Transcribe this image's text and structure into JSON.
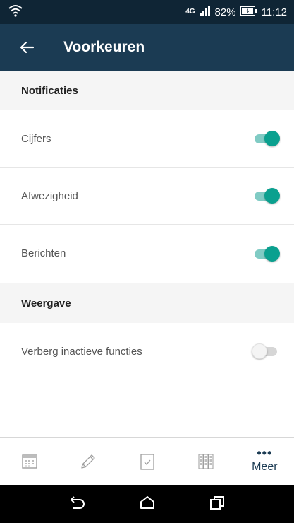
{
  "status_bar": {
    "network": "4G",
    "battery": "82%",
    "time": "11:12",
    "icons": [
      "wifi-icon",
      "signal-icon",
      "battery-icon"
    ]
  },
  "app_bar": {
    "back_icon": "arrow-left-icon",
    "title": "Voorkeuren"
  },
  "sections": [
    {
      "header": "Notificaties",
      "items": [
        {
          "label": "Cijfers",
          "enabled": true
        },
        {
          "label": "Afwezigheid",
          "enabled": true
        },
        {
          "label": "Berichten",
          "enabled": true
        }
      ]
    },
    {
      "header": "Weergave",
      "items": [
        {
          "label": "Verberg inactieve functies",
          "enabled": false
        }
      ]
    }
  ],
  "bottom_tabs": [
    {
      "icon": "calendar-icon"
    },
    {
      "icon": "pencil-icon"
    },
    {
      "icon": "checklist-icon"
    },
    {
      "icon": "grades-grid-icon"
    },
    {
      "icon": "more-dots-icon",
      "label": "Meer"
    }
  ],
  "nav_bar": [
    "back-nav-icon",
    "home-nav-icon",
    "recents-nav-icon"
  ],
  "colors": {
    "status_bar": "#0f2535",
    "app_bar": "#1b3b53",
    "toggle_on": "#0aa08f",
    "section_bg": "#f5f5f5"
  }
}
